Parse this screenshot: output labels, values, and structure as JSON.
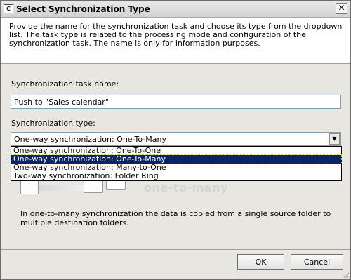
{
  "window": {
    "title": "Select Synchronization Type",
    "app_icon_text": "C",
    "close_glyph": "✕"
  },
  "header": {
    "text": "Provide the name for the synchronization task and choose its type from the dropdown list. The task type is related to the processing mode and configuration of the synchronization task. The name is only for information purposes."
  },
  "form": {
    "task_name_label": "Synchronization task name:",
    "task_name_value": "Push to \"Sales calendar\"",
    "sync_type_label": "Synchronization type:",
    "sync_type_value": "One-way synchronization: One-To-Many",
    "dropdown_arrow": "▼",
    "options": [
      "One-way synchronization: One-To-One",
      "One-way synchronization: One-To-Many",
      "One-way synchronization: Many-to-One",
      "Two-way synchronization: Folder Ring"
    ],
    "selected_index": 1
  },
  "illustration": {
    "caption": "one-to-many"
  },
  "description": "In one-to-many synchronization the data is copied from a single source folder to multiple destination folders.",
  "buttons": {
    "ok": "OK",
    "cancel": "Cancel"
  }
}
